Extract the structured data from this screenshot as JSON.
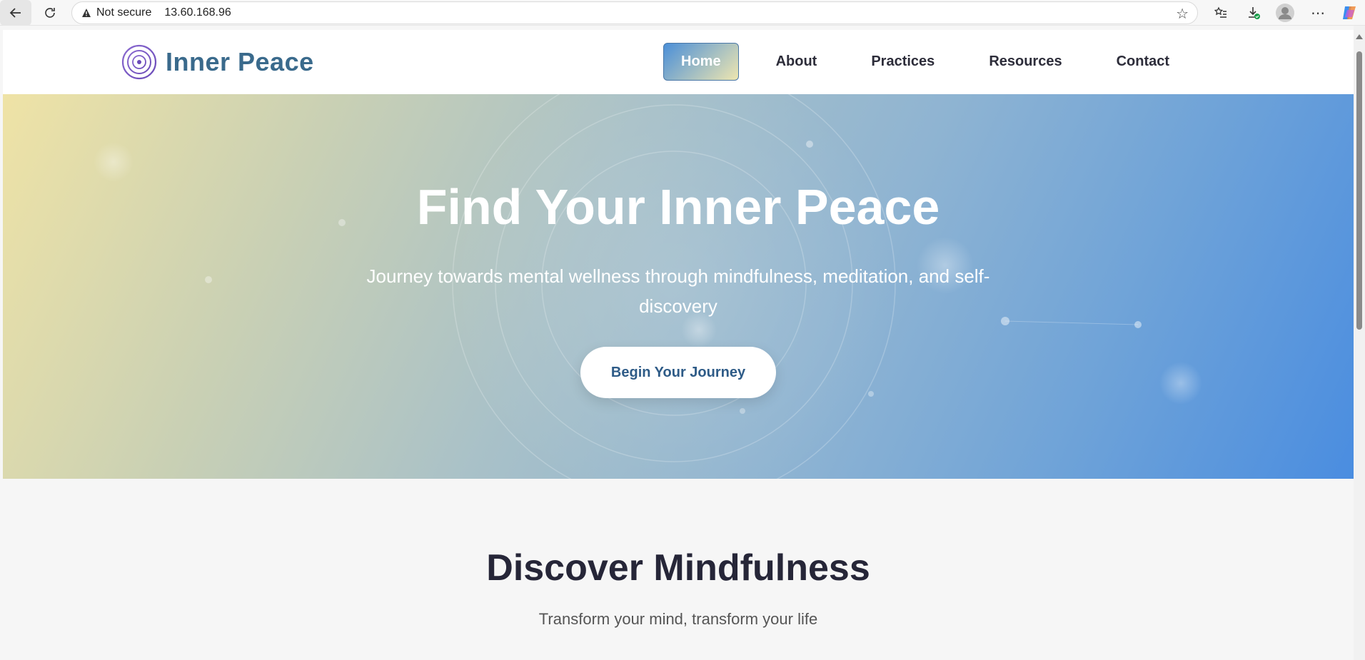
{
  "browser": {
    "security_label": "Not secure",
    "url": "13.60.168.96"
  },
  "header": {
    "logo_text": "Inner Peace",
    "nav": [
      {
        "label": "Home",
        "active": true
      },
      {
        "label": "About",
        "active": false
      },
      {
        "label": "Practices",
        "active": false
      },
      {
        "label": "Resources",
        "active": false
      },
      {
        "label": "Contact",
        "active": false
      }
    ]
  },
  "hero": {
    "title": "Find Your Inner Peace",
    "subtitle": "Journey towards mental wellness through mindfulness, meditation, and self-discovery",
    "cta_label": "Begin Your Journey"
  },
  "section": {
    "title": "Discover Mindfulness",
    "subtitle": "Transform your mind, transform your life"
  },
  "colors": {
    "brand": "#3a6a8c",
    "hero_start": "#efe3a6",
    "hero_end": "#4a8de0",
    "cta_text": "#2e5b87"
  }
}
